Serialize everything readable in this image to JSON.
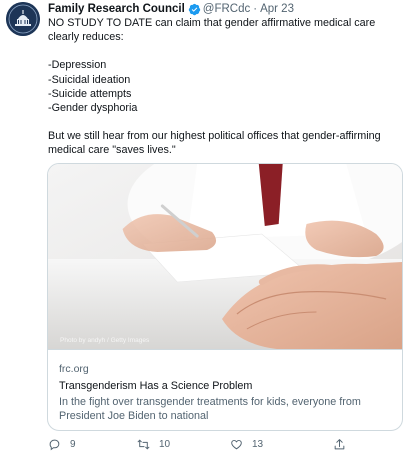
{
  "author": {
    "name": "Family Research Council",
    "handle": "@FRCdc",
    "separator": "·",
    "date": "Apr 23",
    "avatar_icon": "capitol-dome-seal-icon",
    "verified_color": "#1d9bf0"
  },
  "tweet": {
    "lines": [
      "NO STUDY TO DATE can claim that gender affirmative medical care clearly reduces:",
      "-Depression",
      "-Suicidal ideation",
      "-Suicide attempts",
      "-Gender dysphoria",
      "But we still hear from our highest political offices that gender-affirming medical care \"saves lives.\""
    ]
  },
  "card": {
    "image_credit": "Photo by andyh / Getty Images",
    "domain": "frc.org",
    "title": "Transgenderism Has a Science Problem",
    "description": "In the fight over transgender treatments for kids, everyone from President Joe Biden to national"
  },
  "actions": {
    "replies": "9",
    "retweets": "10",
    "likes": "13",
    "icons": [
      "reply-icon",
      "retweet-icon",
      "like-icon",
      "share-icon"
    ]
  },
  "colors": {
    "text": "#0f1419",
    "secondary": "#536471",
    "border": "#cfd9de",
    "accent": "#1d9bf0"
  }
}
